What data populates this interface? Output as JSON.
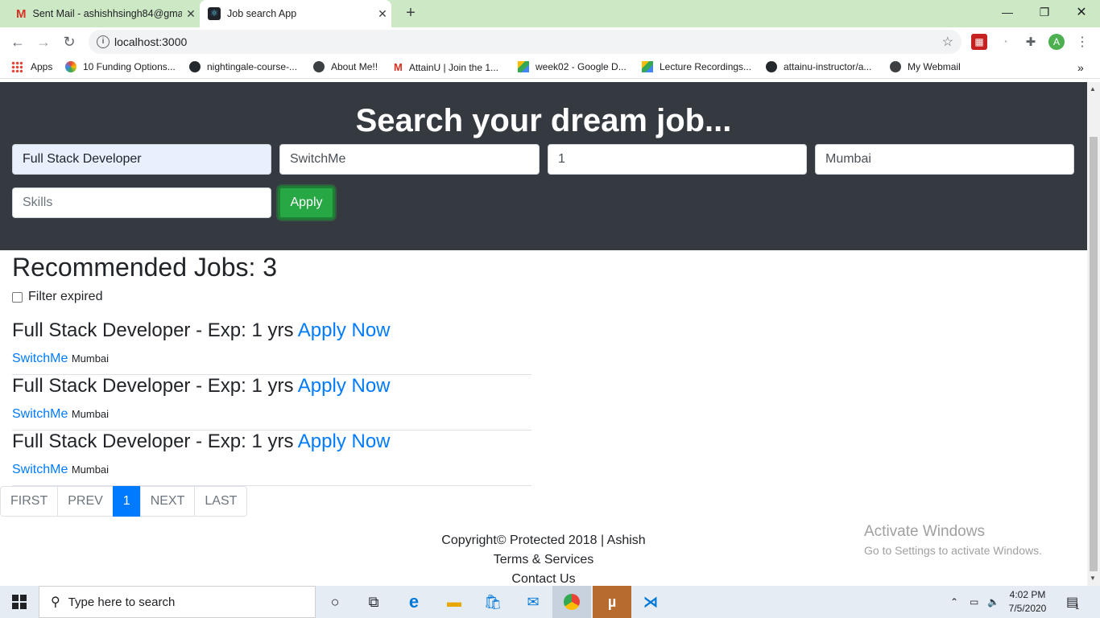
{
  "browser": {
    "tabs": [
      {
        "title": "Sent Mail - ashishhsingh84@gma",
        "icon": "gmail-icon"
      },
      {
        "title": "Job search App",
        "icon": "react-icon"
      }
    ],
    "url": "localhost:3000",
    "profile_initial": "A",
    "bookmarks": [
      {
        "label": "Apps",
        "icon": "apps-grid-icon"
      },
      {
        "label": "10 Funding Options...",
        "icon": "colorful-dots-icon"
      },
      {
        "label": "nightingale-course-...",
        "icon": "github-icon"
      },
      {
        "label": "About Me!!",
        "icon": "globe-icon"
      },
      {
        "label": "AttainU | Join the 1...",
        "icon": "gmail-icon"
      },
      {
        "label": "week02 - Google D...",
        "icon": "google-drive-icon"
      },
      {
        "label": "Lecture Recordings...",
        "icon": "google-drive-icon"
      },
      {
        "label": "attainu-instructor/a...",
        "icon": "github-icon"
      },
      {
        "label": "My Webmail",
        "icon": "globe-icon"
      }
    ]
  },
  "hero": {
    "title": "Search your dream job...",
    "fields": {
      "role": {
        "value": "Full Stack Developer"
      },
      "company": {
        "value": "SwitchMe"
      },
      "experience": {
        "value": "1"
      },
      "location": {
        "value": "Mumbai"
      },
      "skills": {
        "placeholder": "Skills"
      }
    },
    "apply_label": "Apply"
  },
  "results": {
    "heading": "Recommended Jobs: 3",
    "filter_label": "Filter expired",
    "jobs": [
      {
        "title": "Full Stack Developer - Exp: 1 yrs",
        "link": "Apply Now",
        "company": "SwitchMe",
        "location": "Mumbai"
      },
      {
        "title": "Full Stack Developer - Exp: 1 yrs",
        "link": "Apply Now",
        "company": "SwitchMe",
        "location": "Mumbai"
      },
      {
        "title": "Full Stack Developer - Exp: 1 yrs",
        "link": "Apply Now",
        "company": "SwitchMe",
        "location": "Mumbai"
      }
    ]
  },
  "pagination": {
    "first": "FIRST",
    "prev": "PREV",
    "current": "1",
    "next": "NEXT",
    "last": "LAST"
  },
  "footer": {
    "copyright": "Copyright© Protected 2018 | Ashish",
    "terms": "Terms & Services",
    "contact": "Contact Us"
  },
  "watermark": {
    "line1": "Activate Windows",
    "line2": "Go to Settings to activate Windows."
  },
  "taskbar": {
    "search_placeholder": "Type here to search",
    "time": "4:02 PM",
    "date": "7/5/2020",
    "notification_count": "1"
  },
  "colors": {
    "hero_bg": "#343a40",
    "link": "#007bff",
    "apply_button": "#28a745",
    "tabbar": "#cde8c5"
  }
}
